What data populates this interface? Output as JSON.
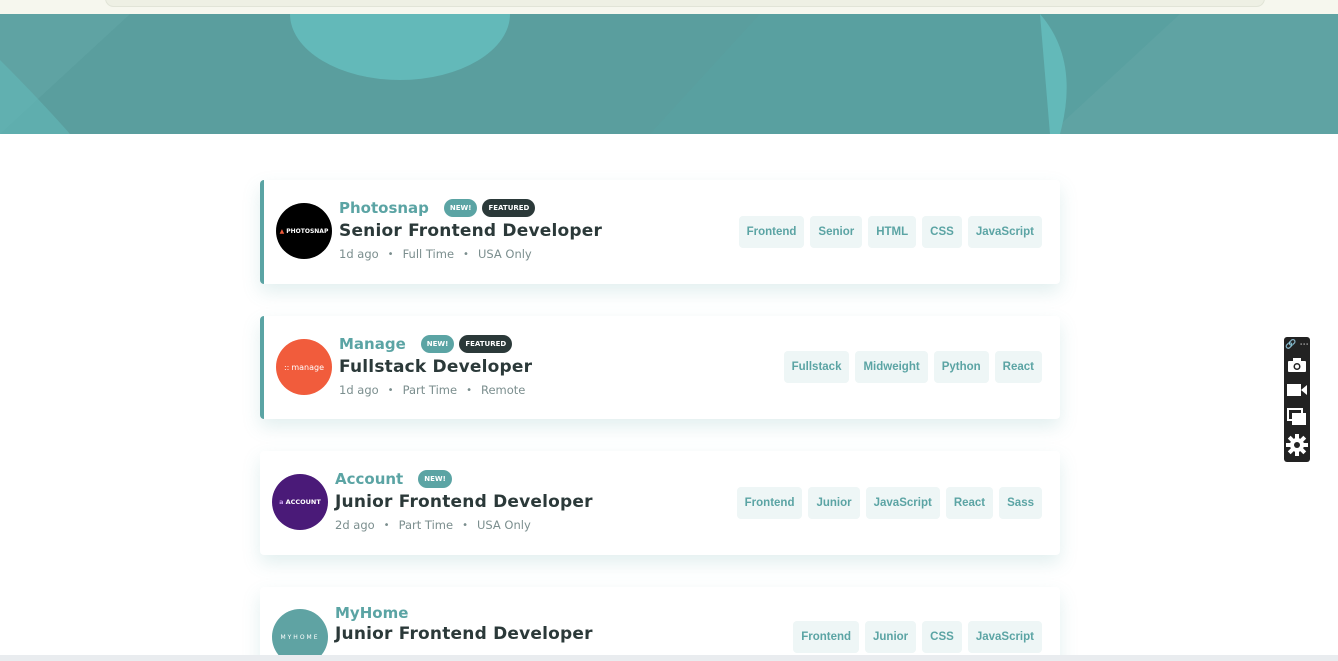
{
  "jobs": [
    {
      "company": "Photosnap",
      "logo_text": "PHOTOSNAP",
      "logo_color": "#000000",
      "is_new": true,
      "is_featured": true,
      "new_label": "NEW!",
      "featured_label": "FEATURED",
      "position": "Senior Frontend Developer",
      "posted_at": "1d ago",
      "contract": "Full Time",
      "location": "USA Only",
      "tags": [
        "Frontend",
        "Senior",
        "HTML",
        "CSS",
        "JavaScript"
      ]
    },
    {
      "company": "Manage",
      "logo_text": "manage",
      "logo_color": "#f15c3c",
      "is_new": true,
      "is_featured": true,
      "new_label": "NEW!",
      "featured_label": "FEATURED",
      "position": "Fullstack Developer",
      "posted_at": "1d ago",
      "contract": "Part Time",
      "location": "Remote",
      "tags": [
        "Fullstack",
        "Midweight",
        "Python",
        "React"
      ]
    },
    {
      "company": "Account",
      "logo_text": "ACCOUNT",
      "logo_color": "#4a1a78",
      "is_new": true,
      "is_featured": false,
      "new_label": "NEW!",
      "position": "Junior Frontend Developer",
      "posted_at": "2d ago",
      "contract": "Part Time",
      "location": "USA Only",
      "tags": [
        "Frontend",
        "Junior",
        "JavaScript",
        "React",
        "Sass"
      ]
    },
    {
      "company": "MyHome",
      "logo_text": "MYHOME",
      "logo_color": "#5fa3a3",
      "is_new": false,
      "is_featured": false,
      "position": "Junior Frontend Developer",
      "tags": [
        "Frontend",
        "Junior",
        "CSS",
        "JavaScript"
      ]
    }
  ],
  "colors": {
    "accent": "#5ba4a4",
    "dark": "#2b3939",
    "hero": "#5fa3a3",
    "tag_bg": "#eef6f6"
  },
  "toolbar": {
    "icons": [
      "link-icon",
      "more-icon",
      "camera-icon",
      "video-icon",
      "screens-icon",
      "settings-icon"
    ]
  }
}
